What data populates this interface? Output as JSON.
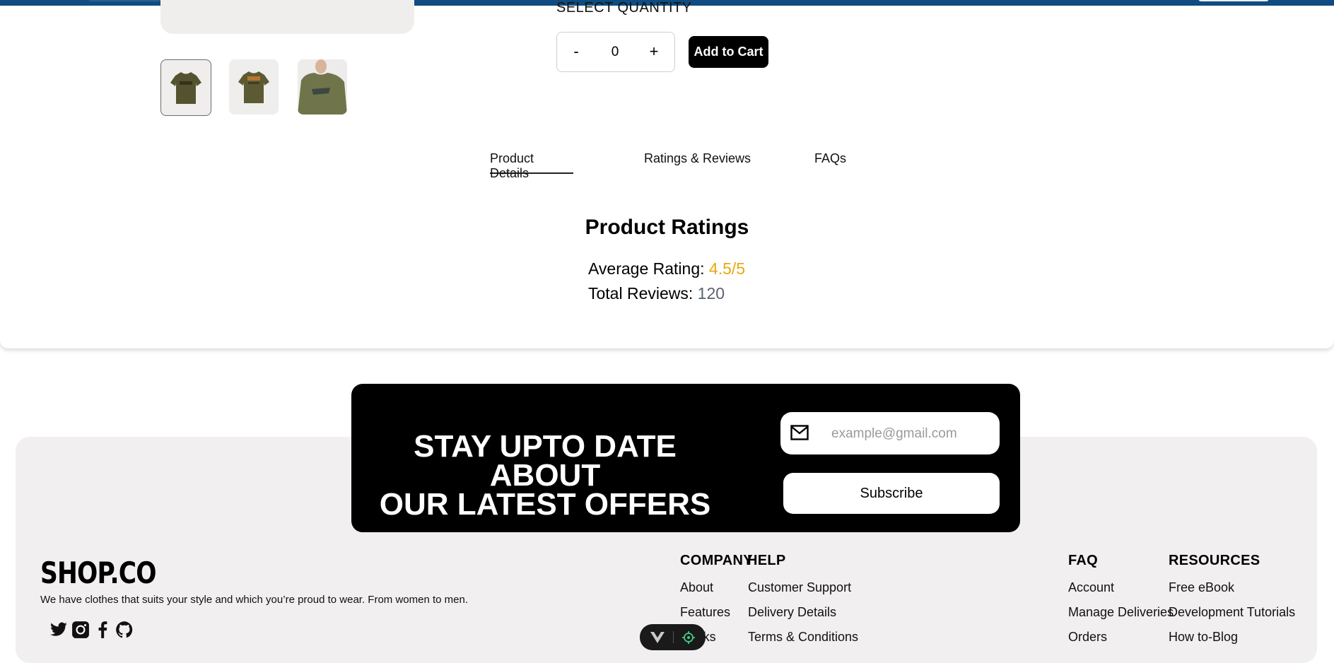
{
  "quantity": {
    "label": "SELECT QUANTITY",
    "minus": "-",
    "value": "0",
    "plus": "+",
    "add_to_cart": "Add to Cart"
  },
  "tabs": {
    "details": "Product Details",
    "ratings": "Ratings & Reviews",
    "faqs": "FAQs",
    "active": "Product Details"
  },
  "ratings": {
    "title": "Product Ratings",
    "average_label": "Average Rating:",
    "average_value": "4.5/5",
    "total_label": "Total Reviews:",
    "total_value": "120"
  },
  "newsletter": {
    "title_line1": "STAY UPTO DATE ABOUT",
    "title_line2": "OUR LATEST OFFERS",
    "email_placeholder": "example@gmail.com",
    "subscribe_label": "Subscribe"
  },
  "brand": {
    "logo": "SHOP.CO",
    "tagline": "We have clothes that suits your style and which you’re proud to wear. From women to men."
  },
  "footer": {
    "company": {
      "heading": "COMPANY",
      "links": [
        "About",
        "Features",
        "Works"
      ]
    },
    "help": {
      "heading": "HELP",
      "links": [
        "Customer Support",
        "Delivery Details",
        "Terms & Conditions"
      ]
    },
    "faq": {
      "heading": "FAQ",
      "links": [
        "Account",
        "Manage Deliveries",
        "Orders"
      ]
    },
    "resources": {
      "heading": "RESOURCES",
      "links": [
        "Free eBook",
        "Development Tutorials",
        "How to-Blog"
      ]
    }
  },
  "icons": [
    "mail-icon",
    "twitter-icon",
    "instagram-icon",
    "facebook-icon",
    "github-icon",
    "vue-devtools-icon",
    "target-icon"
  ],
  "colors": {
    "topbar": "#0f4c81",
    "rating_accent": "#e7a90f",
    "reviews_count": "#5b6270",
    "footer_bg": "#f1eff0",
    "newsletter_bg": "#000000"
  }
}
